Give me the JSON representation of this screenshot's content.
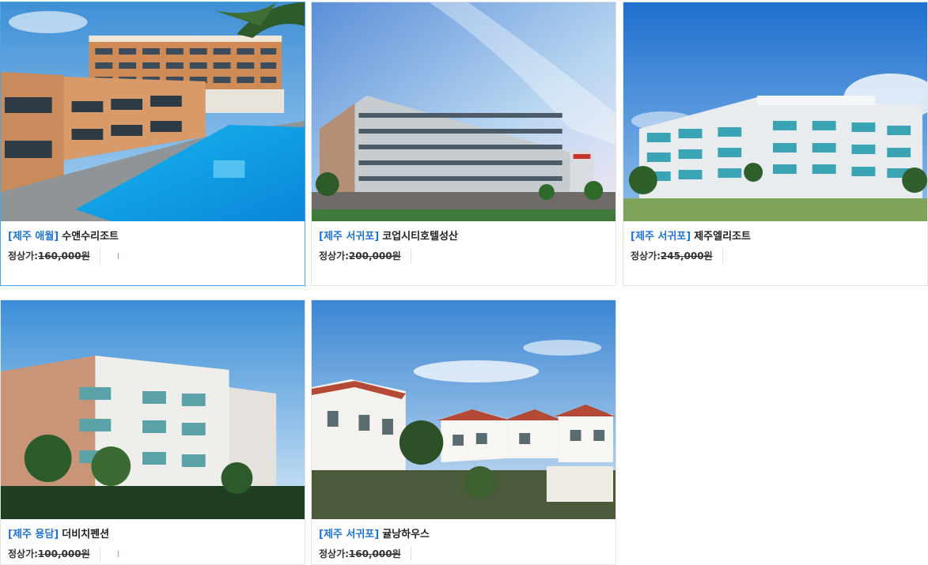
{
  "colors": {
    "region": "#1e73d6",
    "selected_border": "#4aa6e8",
    "card_border": "#e3e3e3"
  },
  "products": [
    {
      "region": "[제주 애월]",
      "name": "수앤수리조트",
      "price_label": "정상가:",
      "price": "160,000원",
      "image": "hotel-pool-photo",
      "selected": true
    },
    {
      "region": "[제주 서귀포]",
      "name": "코업시티호텔성산",
      "price_label": "정상가:",
      "price": "200,000원",
      "image": "city-hotel-photo",
      "selected": false
    },
    {
      "region": "[제주 서귀포]",
      "name": "제주엘리조트",
      "price_label": "정상가:",
      "price": "245,000원",
      "image": "resort-building-photo",
      "selected": false
    },
    {
      "region": "[제주 용담]",
      "name": "더비치펜션",
      "price_label": "정상가:",
      "price": "100,000원",
      "image": "beach-pension-photo",
      "selected": false
    },
    {
      "region": "[제주 서귀포]",
      "name": "귤낭하우스",
      "price_label": "정상가:",
      "price": "160,000원",
      "image": "white-villa-photo",
      "selected": false
    }
  ]
}
